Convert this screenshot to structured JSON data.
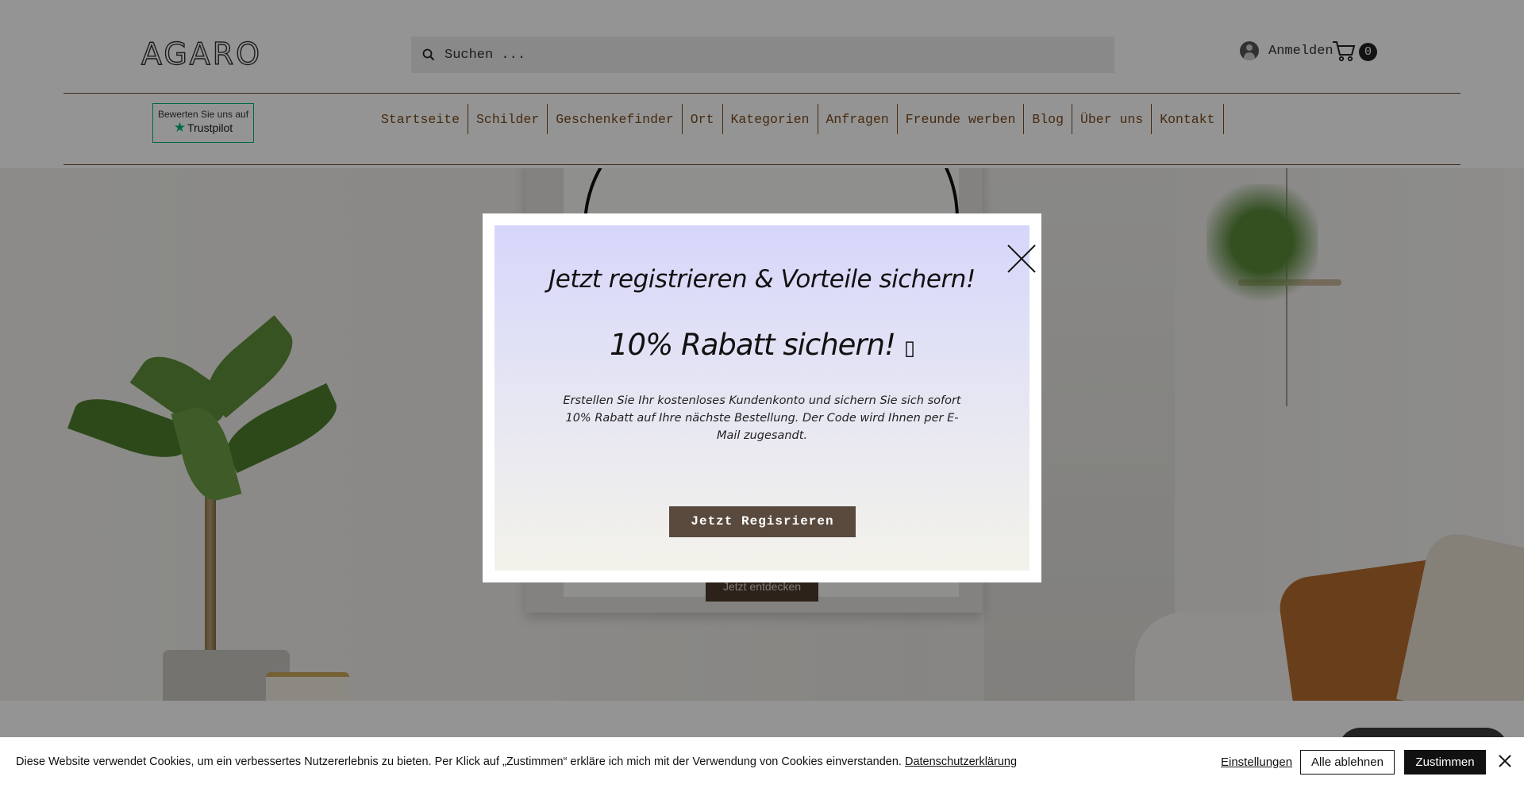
{
  "header": {
    "logo": "AGARO",
    "search_placeholder": "Suchen ...",
    "login_label": "Anmelden",
    "cart_count": "0"
  },
  "trustpilot": {
    "top": "Bewerten Sie uns auf",
    "brand": "Trustpilot"
  },
  "nav": {
    "items": [
      {
        "label": "Startseite"
      },
      {
        "label": "Schilder"
      },
      {
        "label": "Geschenkefinder"
      },
      {
        "label": "Ort"
      },
      {
        "label": "Kategorien"
      },
      {
        "label": "Anfragen"
      },
      {
        "label": "Freunde werben"
      },
      {
        "label": "Blog"
      },
      {
        "label": "Über uns"
      },
      {
        "label": "Kontakt"
      }
    ]
  },
  "hero": {
    "cta_label": "Jetzt entdecken"
  },
  "modal": {
    "title": "Jetzt registrieren & Vorteile sichern!",
    "subtitle": "10% Rabatt sichern! ",
    "subtitle_glyph": "▯",
    "body": "Erstellen Sie Ihr kostenloses Kundenkonto und sichern Sie sich sofort 10% Rabatt auf Ihre nächste Bestellung. Der Code wird Ihnen per E-Mail zugesandt.",
    "button_label": "Jetzt Regisrieren"
  },
  "cookie": {
    "text": "Diese Website verwendet Cookies, um ein verbessertes Nutzererlebnis zu bieten. Per Klick auf „Zustimmen“ erkläre ich mich mit der Verwendung von Cookies einverstanden. ",
    "privacy_link": "Datenschutzerklärung",
    "settings_label": "Einstellungen",
    "reject_label": "Alle ablehnen",
    "accept_label": "Zustimmen"
  },
  "icons": {
    "search": "search-icon",
    "user": "user-icon",
    "cart": "cart-icon",
    "close": "close-icon",
    "star": "star-icon"
  },
  "colors": {
    "nav_text": "#7a4a1c",
    "divider": "#6b4a30",
    "trustpilot_green": "#00b67a",
    "modal_button": "#5a4a3e",
    "cookie_accept": "#111111"
  }
}
